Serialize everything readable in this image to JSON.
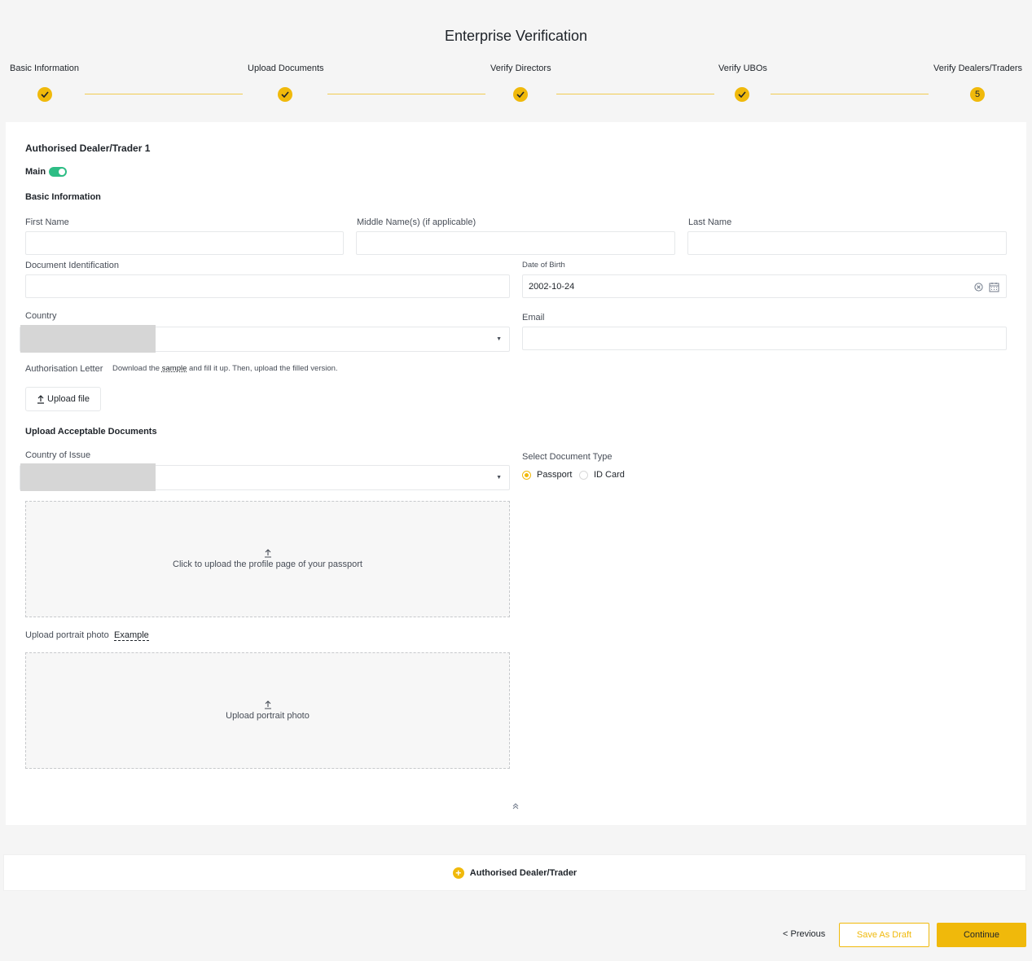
{
  "title": "Enterprise Verification",
  "steps": [
    {
      "label": "Basic Information",
      "state": "done"
    },
    {
      "label": "Upload Documents",
      "state": "done"
    },
    {
      "label": "Verify Directors",
      "state": "done"
    },
    {
      "label": "Verify UBOs",
      "state": "done"
    },
    {
      "label": "Verify Dealers/Traders",
      "state": "current",
      "number": "5"
    }
  ],
  "form": {
    "section_title": "Authorised Dealer/Trader 1",
    "main_label": "Main",
    "main_on": true,
    "basic_info_title": "Basic Information",
    "first_name_label": "First Name",
    "middle_name_label": "Middle Name(s) (if applicable)",
    "last_name_label": "Last Name",
    "doc_id_label": "Document Identification",
    "dob_label": "Date of Birth",
    "dob_value": "2002-10-24",
    "country_label": "Country",
    "email_label": "Email",
    "auth_letter_label": "Authorisation Letter",
    "auth_letter_text_pre": "Download the",
    "auth_letter_link": "sample",
    "auth_letter_text_post": "and fill it up. Then, upload the filled version.",
    "upload_file_label": "Upload file",
    "acceptable_docs_title": "Upload Acceptable Documents",
    "country_issue_label": "Country of Issue",
    "doc_type_label": "Select Document Type",
    "doc_type_options": [
      "Passport",
      "ID Card"
    ],
    "doc_type_selected": "Passport",
    "passport_upload_text": "Click to upload the profile page of your passport",
    "portrait_label": "Upload portrait photo",
    "portrait_example": "Example",
    "portrait_upload_text": "Upload portrait photo"
  },
  "add_dealer_label": "Authorised Dealer/Trader",
  "footer": {
    "previous_label": "< Previous",
    "save_draft_label": "Save As Draft",
    "continue_label": "Continue"
  },
  "colors": {
    "accent": "#f0b90b",
    "toggle": "#2ebd85"
  }
}
